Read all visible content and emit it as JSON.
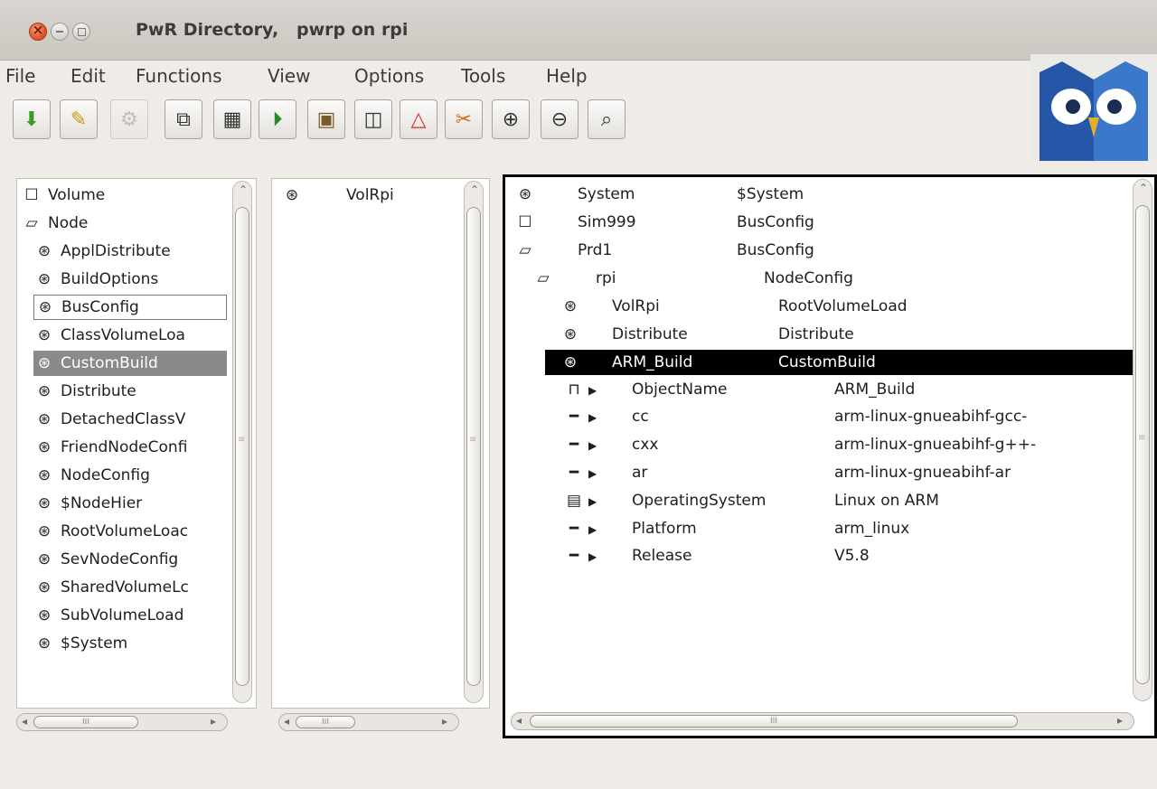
{
  "window": {
    "title": "PwR Directory,   pwrp on rpi"
  },
  "menu": [
    "File",
    "Edit",
    "Functions",
    "View",
    "Options",
    "Tools",
    "Help"
  ],
  "toolbar": [
    {
      "name": "save-icon",
      "glyph": "⬇",
      "color": "#3f9a2a",
      "disabled": false
    },
    {
      "name": "edit-pencil-icon",
      "glyph": "✎",
      "color": "#c59a14",
      "disabled": false
    },
    {
      "name": "build-gears-icon",
      "glyph": "⚙",
      "color": "#888",
      "disabled": true
    },
    {
      "name": "open-object-icon",
      "glyph": "⧉",
      "color": "#333",
      "disabled": false
    },
    {
      "name": "plc-diagram-icon",
      "glyph": "▦",
      "color": "#333",
      "disabled": false
    },
    {
      "name": "run-icon",
      "glyph": "⏵",
      "color": "#2a8a2a",
      "disabled": false
    },
    {
      "name": "package-icon",
      "glyph": "▣",
      "color": "#7a5a2a",
      "disabled": false
    },
    {
      "name": "split-view-icon",
      "glyph": "◫",
      "color": "#333",
      "disabled": false
    },
    {
      "name": "warning-icon",
      "glyph": "△",
      "color": "#d3301c",
      "disabled": false
    },
    {
      "name": "tools-icon",
      "glyph": "✂",
      "color": "#d66a12",
      "disabled": false
    },
    {
      "name": "zoom-in-icon",
      "glyph": "⊕",
      "color": "#333",
      "disabled": false
    },
    {
      "name": "zoom-out-icon",
      "glyph": "⊖",
      "color": "#333",
      "disabled": false
    },
    {
      "name": "zoom-reset-icon",
      "glyph": "⌕",
      "color": "#333",
      "disabled": false
    }
  ],
  "left_pane": {
    "items": [
      {
        "label": "Volume",
        "icon": "folder-icon",
        "glyph": "☐",
        "state": ""
      },
      {
        "label": "Node",
        "icon": "folder-open-icon",
        "glyph": "▱",
        "state": ""
      },
      {
        "label": "ApplDistribute",
        "icon": "object-icon",
        "glyph": "⊛",
        "state": ""
      },
      {
        "label": "BuildOptions",
        "icon": "object-icon",
        "glyph": "⊛",
        "state": ""
      },
      {
        "label": "BusConfig",
        "icon": "object-icon",
        "glyph": "⊛",
        "state": "framed"
      },
      {
        "label": "ClassVolumeLoa",
        "icon": "object-icon",
        "glyph": "⊛",
        "state": ""
      },
      {
        "label": "CustomBuild",
        "icon": "object-icon",
        "glyph": "⊛",
        "state": "selected"
      },
      {
        "label": "Distribute",
        "icon": "object-icon",
        "glyph": "⊛",
        "state": ""
      },
      {
        "label": "DetachedClassV",
        "icon": "object-icon",
        "glyph": "⊛",
        "state": ""
      },
      {
        "label": "FriendNodeConfi",
        "icon": "object-icon",
        "glyph": "⊛",
        "state": ""
      },
      {
        "label": "NodeConfig",
        "icon": "object-icon",
        "glyph": "⊛",
        "state": ""
      },
      {
        "label": "$NodeHier",
        "icon": "object-icon",
        "glyph": "⊛",
        "state": ""
      },
      {
        "label": "RootVolumeLoac",
        "icon": "object-icon",
        "glyph": "⊛",
        "state": ""
      },
      {
        "label": "SevNodeConfig",
        "icon": "object-icon",
        "glyph": "⊛",
        "state": ""
      },
      {
        "label": "SharedVolumeLc",
        "icon": "object-icon",
        "glyph": "⊛",
        "state": ""
      },
      {
        "label": "SubVolumeLoad",
        "icon": "object-icon",
        "glyph": "⊛",
        "state": ""
      },
      {
        "label": "$System",
        "icon": "object-icon",
        "glyph": "⊛",
        "state": ""
      }
    ]
  },
  "middle_pane": {
    "items": [
      {
        "label": "VolRpi",
        "icon": "object-icon",
        "glyph": "⊛"
      }
    ]
  },
  "right_pane": {
    "objects": [
      {
        "name": "System",
        "class": "$System",
        "icon": "object-icon",
        "glyph": "⊛",
        "indent": 0,
        "selected": false
      },
      {
        "name": "Sim999",
        "class": "BusConfig",
        "icon": "folder-icon",
        "glyph": "☐",
        "indent": 0,
        "selected": false
      },
      {
        "name": "Prd1",
        "class": "BusConfig",
        "icon": "folder-open-icon",
        "glyph": "▱",
        "indent": 0,
        "selected": false
      },
      {
        "name": "rpi",
        "class": "NodeConfig",
        "icon": "folder-open-icon",
        "glyph": "▱",
        "indent": 1,
        "selected": false
      },
      {
        "name": "VolRpi",
        "class": "RootVolumeLoad",
        "icon": "object-icon",
        "glyph": "⊛",
        "indent": 2,
        "selected": false
      },
      {
        "name": "Distribute",
        "class": "Distribute",
        "icon": "object-icon",
        "glyph": "⊛",
        "indent": 2,
        "selected": false
      },
      {
        "name": "ARM_Build",
        "class": "CustomBuild",
        "icon": "object-icon",
        "glyph": "⊛",
        "indent": 2,
        "selected": true
      }
    ],
    "attributes": [
      {
        "name": "ObjectName",
        "value": "ARM_Build",
        "icon": "objectname-attr-icon",
        "glyph": "⊓"
      },
      {
        "name": "cc",
        "value": "arm-linux-gnueabihf-gcc-",
        "icon": "attribute-icon",
        "glyph": "━"
      },
      {
        "name": "cxx",
        "value": "arm-linux-gnueabihf-g++-",
        "icon": "attribute-icon",
        "glyph": "━"
      },
      {
        "name": "ar",
        "value": "arm-linux-gnueabihf-ar",
        "icon": "attribute-icon",
        "glyph": "━"
      },
      {
        "name": "OperatingSystem",
        "value": "Linux on ARM",
        "icon": "enum-attr-icon",
        "glyph": "▤"
      },
      {
        "name": "Platform",
        "value": "arm_linux",
        "icon": "attribute-icon",
        "glyph": "━"
      },
      {
        "name": "Release",
        "value": "V5.8",
        "icon": "attribute-icon",
        "glyph": "━"
      }
    ]
  },
  "scroll": {
    "grip": "III"
  }
}
